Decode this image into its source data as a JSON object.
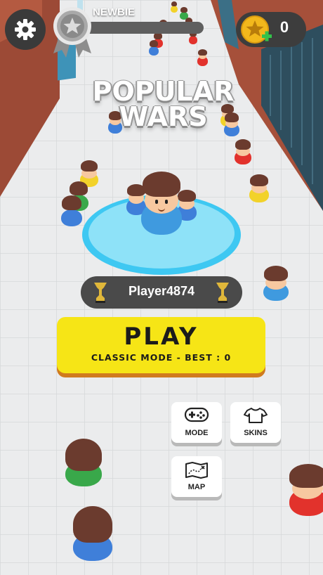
{
  "title": {
    "line1": "POPULAR",
    "line2": "WARS"
  },
  "rank": {
    "name": "NEWBIE",
    "progress": 0.0
  },
  "coins": {
    "count": "0"
  },
  "player": {
    "name": "Player4874"
  },
  "play": {
    "label": "PLAY",
    "subtitle": "CLASSIC MODE - BEST : 0"
  },
  "menu": {
    "mode_label": "MODE",
    "skins_label": "SKINS",
    "map_label": "MAP"
  },
  "colors": {
    "play_button": "#f6e516",
    "play_shadow": "#d07b1e",
    "arena_ring": "#3ec8f2",
    "coin_gold": "#f2b81c",
    "coin_plus": "#33c24a"
  }
}
